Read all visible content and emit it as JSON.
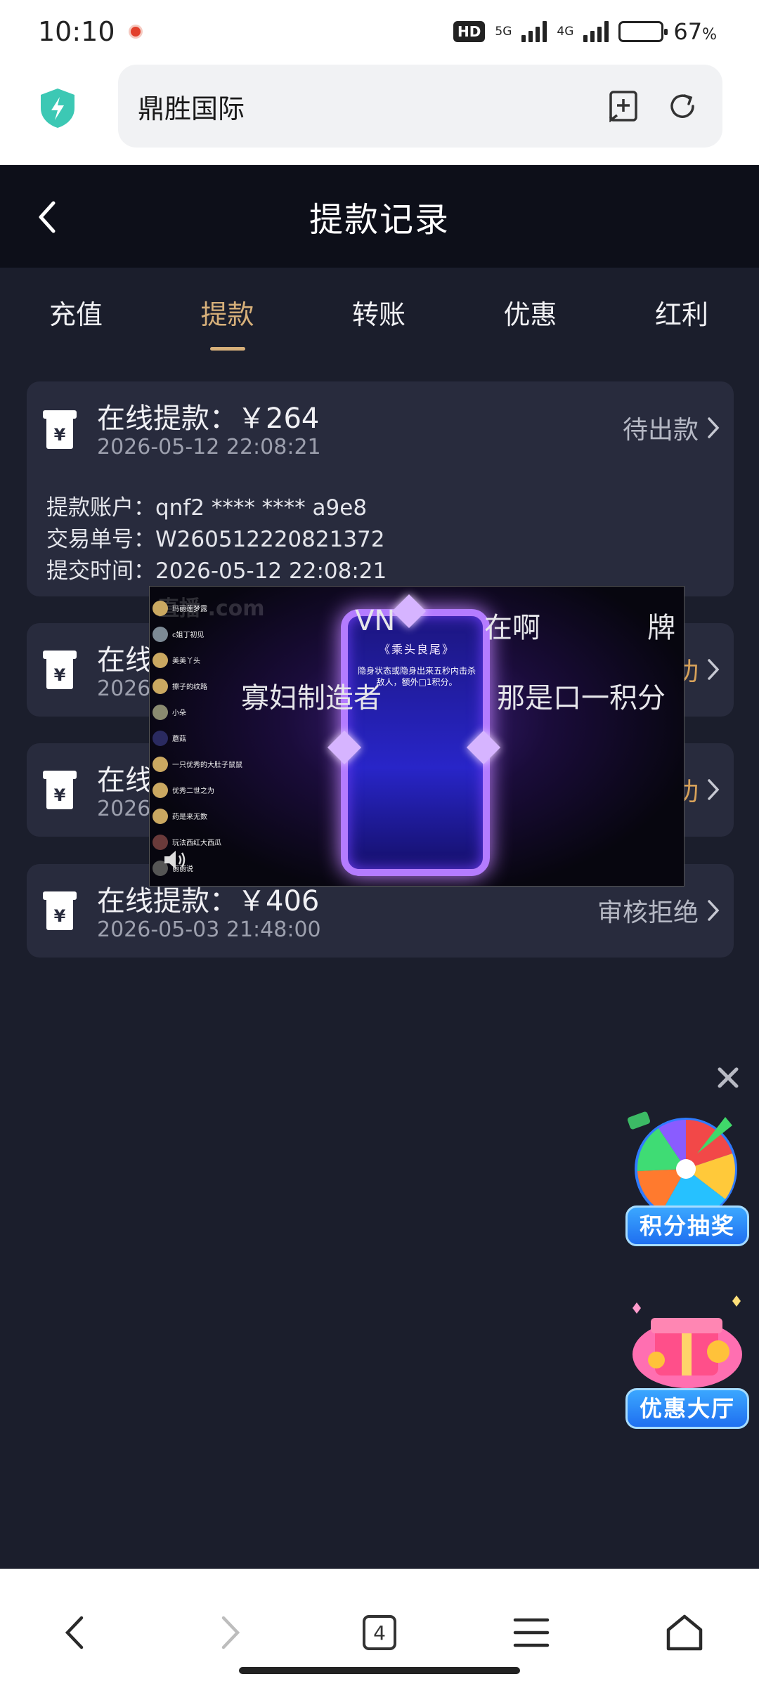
{
  "status_bar": {
    "time": "10:10",
    "hd_badge": "HD",
    "net_5g": "5G",
    "net_4g": "4G",
    "battery_percent": "67",
    "battery_unit": "%",
    "battery_level": 0.67
  },
  "browser": {
    "url_text": "鼎胜国际",
    "tab_count": "4"
  },
  "header": {
    "title": "提款记录"
  },
  "tabs": [
    {
      "label": "充值"
    },
    {
      "label": "提款"
    },
    {
      "label": "转账"
    },
    {
      "label": "优惠"
    },
    {
      "label": "红利"
    }
  ],
  "active_tab": "提款",
  "records": [
    {
      "title": "在线提款：￥264",
      "time": "2026-05-12 22:08:21",
      "status": "待出款",
      "details": [
        {
          "key": "提款账户：",
          "value": "qnf2 **** **** a9e8"
        },
        {
          "key": "交易单号：",
          "value": "W260512220821372"
        },
        {
          "key": "提交时间：",
          "value": "2026-05-12 22:08:21"
        }
      ]
    },
    {
      "title": "在线",
      "time": "2026-",
      "status": "功"
    },
    {
      "title": "在线",
      "time": "2026-",
      "status": "功"
    },
    {
      "title": "在线提款：￥406",
      "time": "2026-05-03 21:48:00",
      "status": "审核拒绝"
    }
  ],
  "video_overlay": {
    "logo_text": "直播 .com",
    "danmu": [
      "VN",
      "在啊",
      "牌",
      "寡妇制造者",
      "那是口一积分"
    ],
    "frame_title": "《乘头良尾》",
    "frame_text": "隐身状态或隐身出来五秒内击杀敌人，额外□1积分。",
    "chat_names": [
      "玛丽莲梦露",
      "c姐丁初见",
      "美美丫头",
      "擦子的纹路",
      "小朵",
      "蘑菇",
      "一只优秀的大肚子鼠鼠",
      "优秀二世之为",
      "药是来无数",
      "玩法西红大西瓜",
      "丽丽说"
    ]
  },
  "promos": [
    {
      "label": "积分抽奖"
    },
    {
      "label": "优惠大厅"
    }
  ],
  "colors": {
    "accent_gold": "#d7b07a",
    "status_orange": "#d8a25a",
    "card_bg": "#282b3d",
    "page_bg": "#1b1e2c",
    "header_bg": "#0d0f19"
  },
  "icons": [
    "shield-bolt-icon",
    "bookmark-add-icon",
    "refresh-icon",
    "chevron-left-icon",
    "yen-ticket-icon",
    "chevron-right-icon",
    "speaker-icon",
    "close-icon",
    "wheel-icon",
    "gift-icon",
    "back-arrow-icon",
    "forward-arrow-icon",
    "menu-icon",
    "home-icon"
  ]
}
